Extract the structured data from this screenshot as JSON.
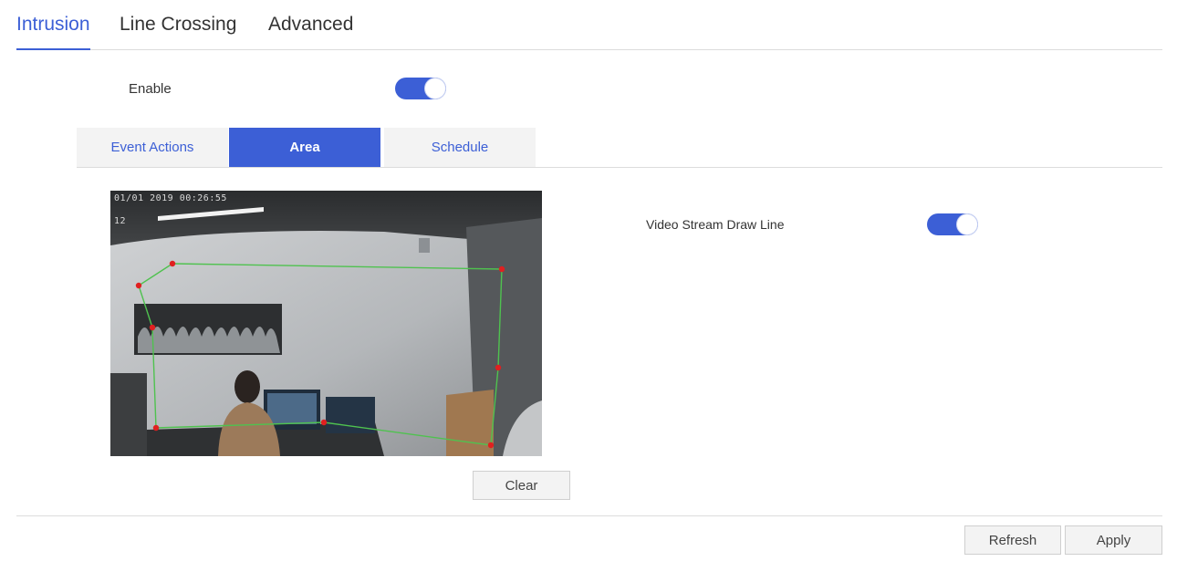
{
  "tabs": {
    "items": [
      "Intrusion",
      "Line Crossing",
      "Advanced"
    ],
    "active": "Intrusion"
  },
  "enable": {
    "label": "Enable",
    "on": true
  },
  "subtabs": {
    "items": [
      "Event Actions",
      "Area",
      "Schedule"
    ],
    "active": "Area"
  },
  "video": {
    "osd_text": "01/01 2019 00:26:55",
    "osd_text2": "12"
  },
  "draw_line": {
    "label": "Video Stream Draw Line",
    "on": true
  },
  "buttons": {
    "clear": "Clear",
    "refresh": "Refresh",
    "apply": "Apply"
  },
  "colors": {
    "accent": "#3c5fd6",
    "region_line": "#4fc24f",
    "region_point": "#e02020"
  }
}
